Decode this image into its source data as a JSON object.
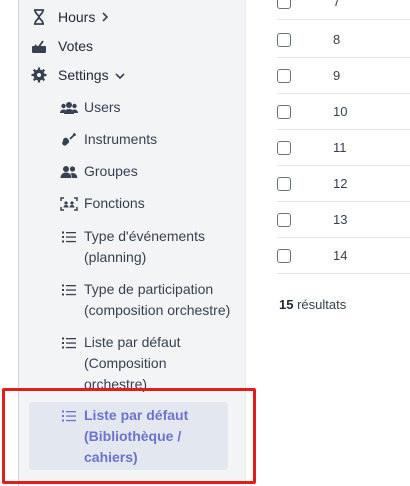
{
  "sidebar": {
    "hours": {
      "label": "Hours"
    },
    "votes": {
      "label": "Votes"
    },
    "settings": {
      "label": "Settings"
    },
    "items": [
      {
        "label": "Users",
        "icon": "users-icon"
      },
      {
        "label": "Instruments",
        "icon": "guitar-icon"
      },
      {
        "label": "Groupes",
        "icon": "user-group-icon"
      },
      {
        "label": "Fonctions",
        "icon": "id-badge-icon"
      },
      {
        "label": "Type d'événements (planning)",
        "icon": "list-icon"
      },
      {
        "label": "Type de participation (composition orchestre)",
        "icon": "list-icon"
      },
      {
        "label": "Liste par défaut (Composition orchestre)",
        "icon": "list-icon"
      },
      {
        "label": "Liste par défaut (Bibliothèque / cahiers)",
        "icon": "list-icon",
        "active": true
      }
    ]
  },
  "table": {
    "rows": [
      "7",
      "8",
      "9",
      "10",
      "11",
      "12",
      "13",
      "14"
    ]
  },
  "results": {
    "count": "15",
    "label": "résultats"
  },
  "colors": {
    "accent": "#6b74cc",
    "highlight": "#e11d1d",
    "sidebar_bg": "#f3f4f6"
  }
}
